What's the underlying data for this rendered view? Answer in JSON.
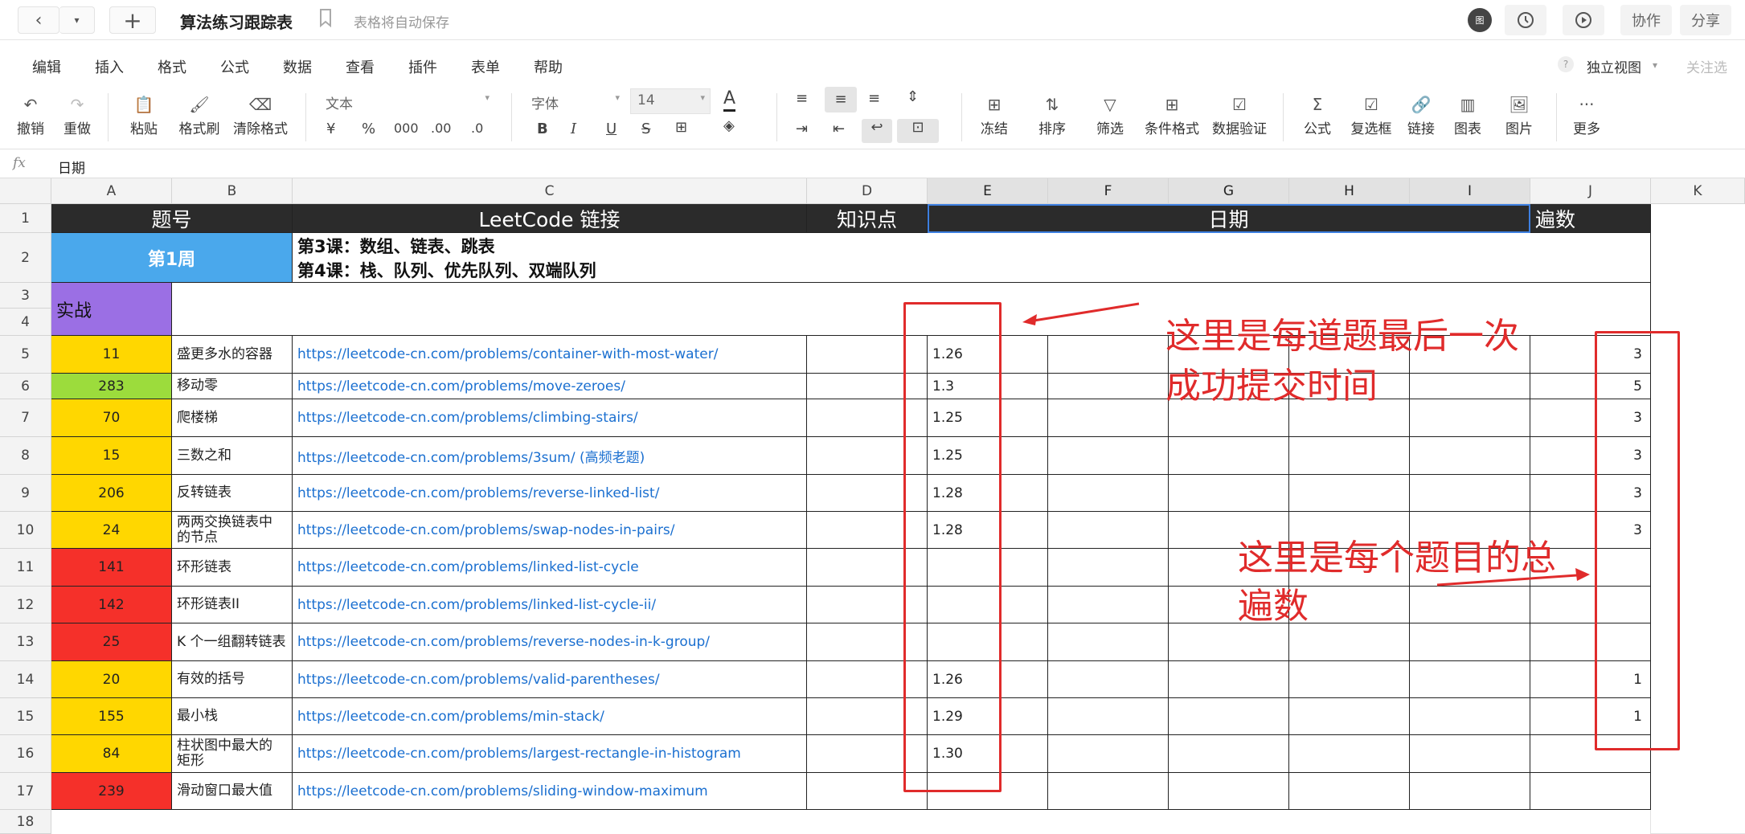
{
  "topbar": {
    "title": "算法练习跟踪表",
    "autosave": "表格将自动保存",
    "avatar_text": "图",
    "collab": "协作",
    "share": "分享"
  },
  "menu": [
    "编辑",
    "插入",
    "格式",
    "公式",
    "数据",
    "查看",
    "插件",
    "表单",
    "帮助"
  ],
  "menu_right": {
    "view": "独立视图",
    "follow": "关注选"
  },
  "toolbar": {
    "undo": "撤销",
    "redo": "重做",
    "paste": "粘贴",
    "format_brush": "格式刷",
    "clear_format": "清除格式",
    "number_format": "文本",
    "currency": "¥",
    "percent": "%",
    "thousands": "000",
    "dec_add": ".00",
    "dec_sub": ".0",
    "font": "字体",
    "font_size": "14",
    "font_color_a": "A",
    "bold": "B",
    "italic": "I",
    "underline": "U",
    "strike": "S",
    "freeze": "冻结",
    "sort": "排序",
    "filter": "筛选",
    "cond_format": "条件格式",
    "data_valid": "数据验证",
    "formula": "公式",
    "checkbox": "复选框",
    "link": "链接",
    "chart": "图表",
    "image": "图片",
    "more": "更多"
  },
  "formula_bar": {
    "fx": "fx",
    "value": "日期"
  },
  "columns": [
    "A",
    "B",
    "C",
    "D",
    "E",
    "F",
    "G",
    "H",
    "I",
    "J",
    "K"
  ],
  "rows": [
    "1",
    "2",
    "3",
    "4",
    "5",
    "6",
    "7",
    "8",
    "9",
    "10",
    "11",
    "12",
    "13",
    "14",
    "15",
    "16",
    "17",
    "18"
  ],
  "header_row": {
    "id": "题号",
    "link": "LeetCode 链接",
    "topic": "知识点",
    "date": "日期",
    "count": "遍数"
  },
  "week": {
    "label": "第1周",
    "line1": "第3课：数组、链表、跳表",
    "line2": "第4课：栈、队列、优先队列、双端队列"
  },
  "practice": "实战",
  "problems": [
    {
      "id": "11",
      "name": "盛更多水的容器",
      "url": "https://leetcode-cn.com/problems/container-with-most-water/",
      "date": "1.26",
      "count": "3",
      "color": "#ffd700"
    },
    {
      "id": "283",
      "name": "移动零",
      "url": "https://leetcode-cn.com/problems/move-zeroes/",
      "date": "1.3",
      "count": "5",
      "color": "#9cdc3c"
    },
    {
      "id": "70",
      "name": "爬楼梯",
      "url": "https://leetcode-cn.com/problems/climbing-stairs/",
      "date": "1.25",
      "count": "3",
      "color": "#ffd700"
    },
    {
      "id": "15",
      "name": "三数之和",
      "url": "https://leetcode-cn.com/problems/3sum/ (高频老题)",
      "date": "1.25",
      "count": "3",
      "color": "#ffd700"
    },
    {
      "id": "206",
      "name": "反转链表",
      "url": "https://leetcode-cn.com/problems/reverse-linked-list/",
      "date": "1.28",
      "count": "3",
      "color": "#ffd700"
    },
    {
      "id": "24",
      "name": "两两交换链表中\n的节点",
      "url": "https://leetcode-cn.com/problems/swap-nodes-in-pairs/",
      "date": "1.28",
      "count": "3",
      "color": "#ffd700"
    },
    {
      "id": "141",
      "name": "环形链表",
      "url": "https://leetcode-cn.com/problems/linked-list-cycle",
      "date": "",
      "count": "",
      "color": "#f5302a"
    },
    {
      "id": "142",
      "name": "环形链表II",
      "url": "https://leetcode-cn.com/problems/linked-list-cycle-ii/",
      "date": "",
      "count": "",
      "color": "#f5302a"
    },
    {
      "id": "25",
      "name": "K 个一组翻转链表",
      "url": "https://leetcode-cn.com/problems/reverse-nodes-in-k-group/",
      "date": "",
      "count": "",
      "color": "#f5302a"
    },
    {
      "id": "20",
      "name": "有效的括号",
      "url": "https://leetcode-cn.com/problems/valid-parentheses/",
      "date": "1.26",
      "count": "1",
      "color": "#ffd700"
    },
    {
      "id": "155",
      "name": "最小栈",
      "url": "https://leetcode-cn.com/problems/min-stack/",
      "date": "1.29",
      "count": "1",
      "color": "#ffd700"
    },
    {
      "id": "84",
      "name": "柱状图中最大的\n矩形",
      "url": "https://leetcode-cn.com/problems/largest-rectangle-in-histogram",
      "date": "1.30",
      "count": "",
      "color": "#ffd700"
    },
    {
      "id": "239",
      "name": "滑动窗口最大值",
      "url": "https://leetcode-cn.com/problems/sliding-window-maximum",
      "date": "",
      "count": "",
      "color": "#f5302a"
    }
  ],
  "annotations": {
    "date_note_1": "这里是每道题最后一次",
    "date_note_2": "成功提交时间",
    "count_note_1": "这里是每个题目的总",
    "count_note_2": "遍数"
  },
  "colors": {
    "header_bg": "#2b2b2b",
    "week_bg": "#4aa8ec",
    "practice_bg": "#9b6fe4",
    "annotation": "#e02b2b",
    "link": "#1a6fd0"
  }
}
